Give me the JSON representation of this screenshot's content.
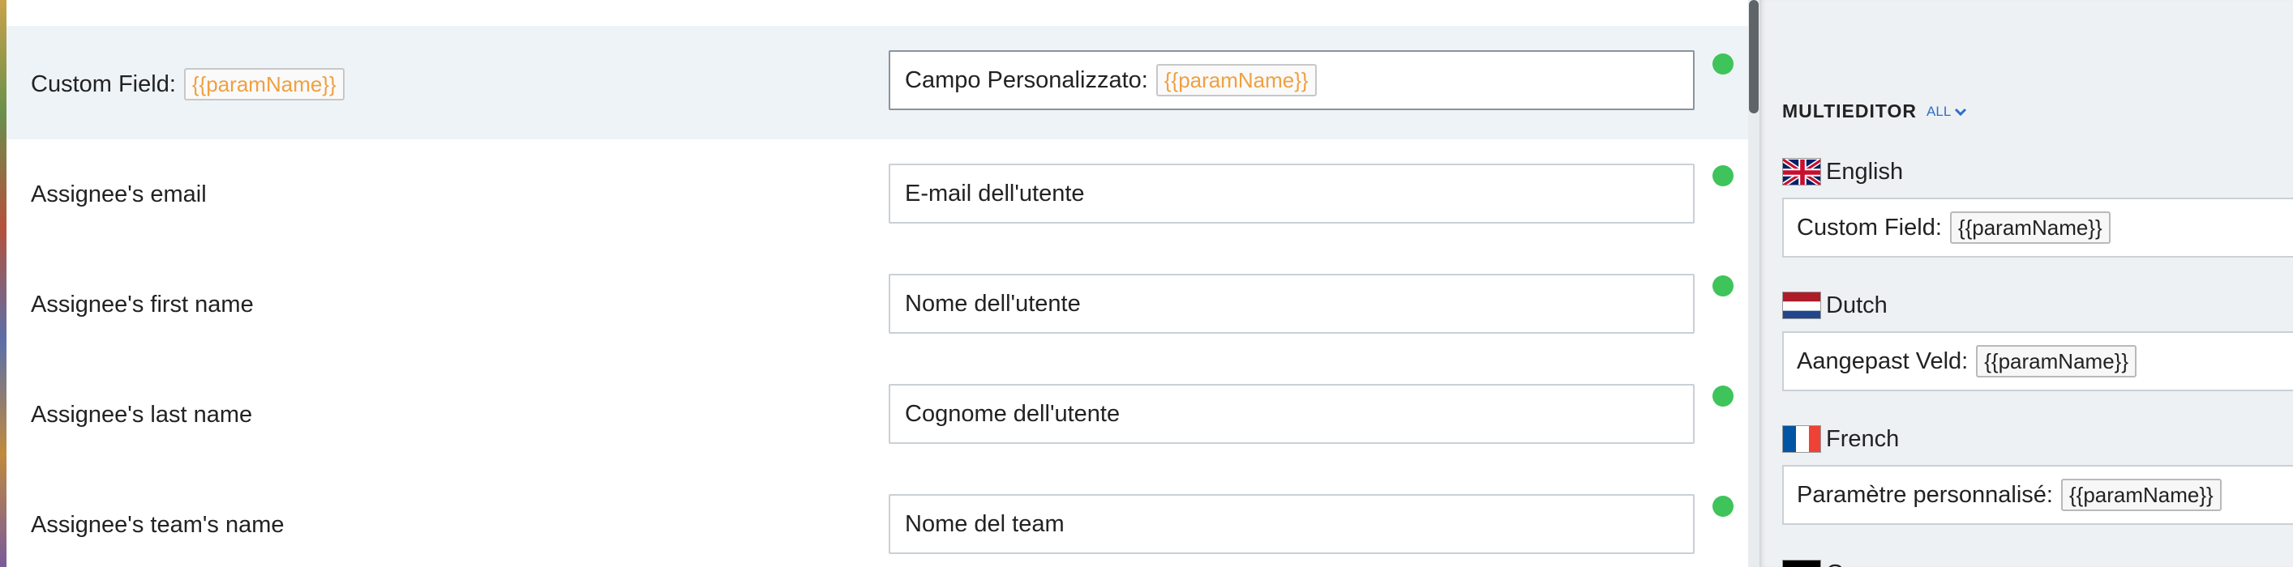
{
  "rows": [
    {
      "label": "Custom Field:",
      "chip": "{{paramName}}",
      "value_text": "Campo Personalizzato:",
      "value_chip": "{{paramName}}",
      "status": "translated"
    },
    {
      "label": "Assignee's email",
      "value_text": "E-mail dell'utente",
      "status": "translated"
    },
    {
      "label": "Assignee's first name",
      "value_text": "Nome dell'utente",
      "status": "translated"
    },
    {
      "label": "Assignee's last name",
      "value_text": "Cognome dell'utente",
      "status": "translated"
    },
    {
      "label": "Assignee's team's name",
      "value_text": "Nome del team",
      "status": "translated"
    }
  ],
  "multieditor": {
    "title": "MULTIEDITOR",
    "toggle_label": "ALL",
    "languages": [
      {
        "name": "English",
        "flag": "uk-flag-icon",
        "text": "Custom Field:",
        "chip": "{{paramName}}"
      },
      {
        "name": "Dutch",
        "flag": "netherlands-flag-icon",
        "text": "Aangepast Veld:",
        "chip": "{{paramName}}"
      },
      {
        "name": "French",
        "flag": "france-flag-icon",
        "text": "Paramètre personnalisé:",
        "chip": "{{paramName}}"
      },
      {
        "name": "G",
        "flag": "germany-flag-icon"
      }
    ]
  },
  "colors": {
    "status_green": "#3ec45a",
    "placeholder_orange": "#f0a040",
    "link_blue": "#2e6fc7",
    "highlight_row": "#eef3f7"
  }
}
